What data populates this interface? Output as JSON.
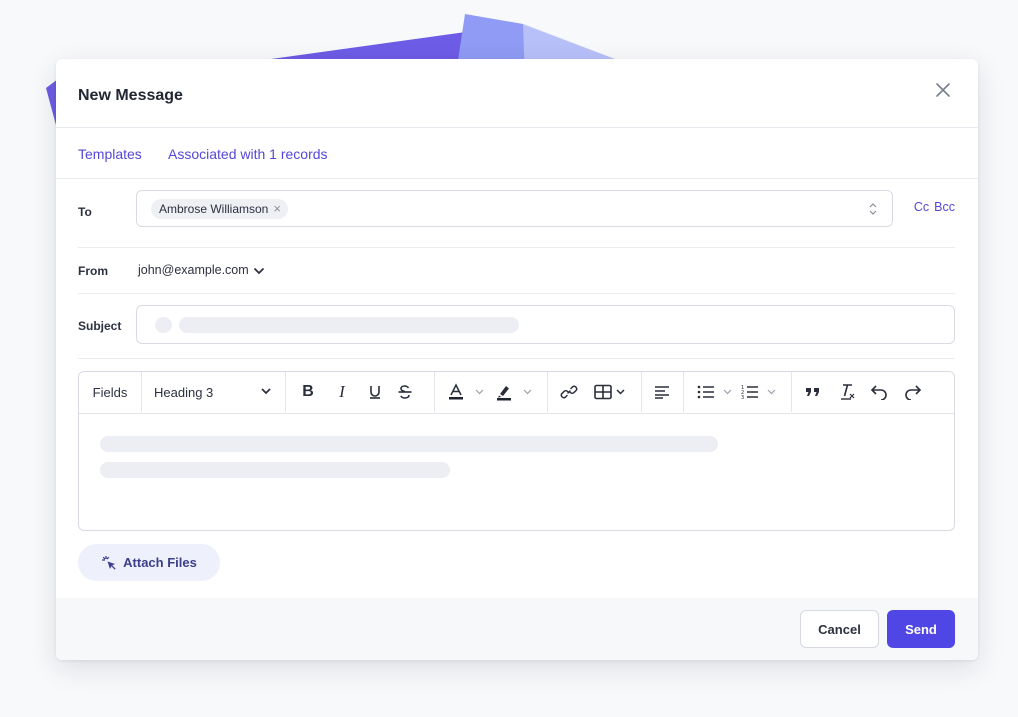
{
  "modal": {
    "title": "New Message"
  },
  "subnav": {
    "templates": "Templates",
    "associated": "Associated with 1 records"
  },
  "to": {
    "label": "To",
    "recipient": "Ambrose Williamson",
    "cc": "Cc",
    "bcc": "Bcc"
  },
  "from": {
    "label": "From",
    "value": "john@example.com"
  },
  "subject": {
    "label": "Subject"
  },
  "toolbar": {
    "fields": "Fields",
    "heading": "Heading 3"
  },
  "attach": {
    "label": "Attach Files"
  },
  "footer": {
    "cancel": "Cancel",
    "send": "Send"
  },
  "colors": {
    "accent": "#4f46e5",
    "link": "#5547d8"
  },
  "icons": [
    "close-icon",
    "remove-chip-icon",
    "updown-icon",
    "chevron-down-icon",
    "bold-icon",
    "italic-icon",
    "underline-icon",
    "strikethrough-icon",
    "text-color-icon",
    "highlight-icon",
    "link-icon",
    "table-icon",
    "align-left-icon",
    "bullet-list-icon",
    "ordered-list-icon",
    "quote-icon",
    "clear-format-icon",
    "undo-icon",
    "redo-icon",
    "attach-icon"
  ]
}
